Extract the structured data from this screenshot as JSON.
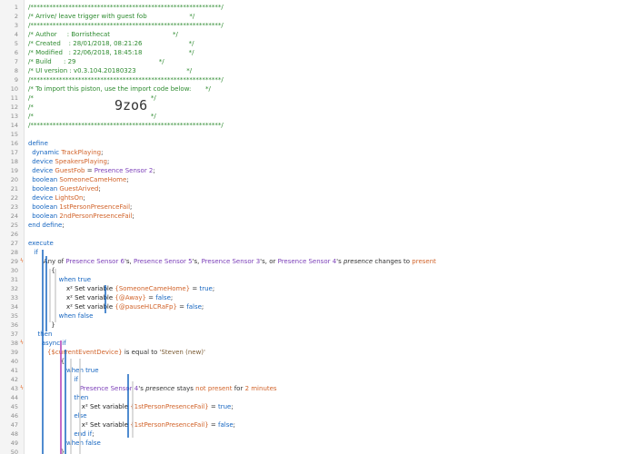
{
  "lines": [
    {
      "n": "1",
      "mk": "",
      "ind": 0,
      "seg": [
        {
          "c": "comment",
          "t": "/************************************************************/"
        }
      ]
    },
    {
      "n": "2",
      "mk": "",
      "ind": 0,
      "seg": [
        {
          "c": "comment",
          "t": "/* Arrive/ leave trigger with guest fob                     */"
        }
      ]
    },
    {
      "n": "3",
      "mk": "",
      "ind": 0,
      "seg": [
        {
          "c": "comment",
          "t": "/************************************************************/"
        }
      ]
    },
    {
      "n": "4",
      "mk": "",
      "ind": 0,
      "seg": [
        {
          "c": "comment",
          "t": "/* Author     : Borristhecat                               */"
        }
      ]
    },
    {
      "n": "5",
      "mk": "",
      "ind": 0,
      "seg": [
        {
          "c": "comment",
          "t": "/* Created    : 28/01/2018, 08:21:26                       */"
        }
      ]
    },
    {
      "n": "6",
      "mk": "",
      "ind": 0,
      "seg": [
        {
          "c": "comment",
          "t": "/* Modified   : 22/06/2018, 18:45:18                       */"
        }
      ]
    },
    {
      "n": "7",
      "mk": "",
      "ind": 0,
      "seg": [
        {
          "c": "comment",
          "t": "/* Build      : 29                                         */"
        }
      ]
    },
    {
      "n": "8",
      "mk": "",
      "ind": 0,
      "seg": [
        {
          "c": "comment",
          "t": "/* UI version : v0.3.104.20180323                         */"
        }
      ]
    },
    {
      "n": "9",
      "mk": "",
      "ind": 0,
      "seg": [
        {
          "c": "comment",
          "t": "/************************************************************/"
        }
      ]
    },
    {
      "n": "10",
      "mk": "",
      "ind": 0,
      "seg": [
        {
          "c": "comment",
          "t": "/* To import this piston, use the import code below:       */"
        }
      ]
    },
    {
      "n": "11",
      "mk": "",
      "ind": 0,
      "seg": [
        {
          "c": "comment",
          "t": "/*                                                          */"
        }
      ]
    },
    {
      "n": "12",
      "mk": "",
      "ind": 0,
      "seg": [
        {
          "c": "comment",
          "t": "/*"
        }
      ]
    },
    {
      "n": "13",
      "mk": "",
      "ind": 0,
      "seg": [
        {
          "c": "comment",
          "t": "/*                                                          */"
        }
      ]
    },
    {
      "n": "14",
      "mk": "",
      "ind": 0,
      "seg": [
        {
          "c": "comment",
          "t": "/************************************************************/"
        }
      ]
    },
    {
      "n": "15",
      "mk": "",
      "ind": 0,
      "seg": []
    },
    {
      "n": "16",
      "mk": "",
      "ind": 0,
      "seg": [
        {
          "c": "kw",
          "t": "define"
        }
      ]
    },
    {
      "n": "17",
      "mk": "",
      "ind": 1,
      "seg": [
        {
          "c": "kw",
          "t": "dynamic "
        },
        {
          "c": "var",
          "t": "TrackPlaying"
        },
        {
          "c": "txt",
          "t": ";"
        }
      ]
    },
    {
      "n": "18",
      "mk": "",
      "ind": 1,
      "seg": [
        {
          "c": "kw",
          "t": "device "
        },
        {
          "c": "var",
          "t": "SpeakersPlaying"
        },
        {
          "c": "txt",
          "t": ";"
        }
      ]
    },
    {
      "n": "19",
      "mk": "",
      "ind": 1,
      "seg": [
        {
          "c": "kw",
          "t": "device "
        },
        {
          "c": "var",
          "t": "GuestFob"
        },
        {
          "c": "txt",
          "t": " = "
        },
        {
          "c": "dev",
          "t": "Presence Sensor 2"
        },
        {
          "c": "txt",
          "t": ";"
        }
      ]
    },
    {
      "n": "20",
      "mk": "",
      "ind": 1,
      "seg": [
        {
          "c": "kw",
          "t": "boolean "
        },
        {
          "c": "var",
          "t": "SomeoneCameHome"
        },
        {
          "c": "txt",
          "t": ";"
        }
      ]
    },
    {
      "n": "21",
      "mk": "",
      "ind": 1,
      "seg": [
        {
          "c": "kw",
          "t": "boolean "
        },
        {
          "c": "var",
          "t": "GuestArived"
        },
        {
          "c": "txt",
          "t": ";"
        }
      ]
    },
    {
      "n": "22",
      "mk": "",
      "ind": 1,
      "seg": [
        {
          "c": "kw",
          "t": "device "
        },
        {
          "c": "var",
          "t": "LightsOn"
        },
        {
          "c": "txt",
          "t": ";"
        }
      ]
    },
    {
      "n": "23",
      "mk": "",
      "ind": 1,
      "seg": [
        {
          "c": "kw",
          "t": "boolean "
        },
        {
          "c": "var",
          "t": "1stPersonPresenceFail"
        },
        {
          "c": "txt",
          "t": ";"
        }
      ]
    },
    {
      "n": "24",
      "mk": "",
      "ind": 1,
      "seg": [
        {
          "c": "kw",
          "t": "boolean "
        },
        {
          "c": "var",
          "t": "2ndPersonPresenceFail"
        },
        {
          "c": "txt",
          "t": ";"
        }
      ]
    },
    {
      "n": "25",
      "mk": "",
      "ind": 0,
      "seg": [
        {
          "c": "kw",
          "t": "end define"
        },
        {
          "c": "txt",
          "t": ";"
        }
      ]
    },
    {
      "n": "26",
      "mk": "",
      "ind": 0,
      "seg": []
    },
    {
      "n": "27",
      "mk": "",
      "ind": 0,
      "seg": [
        {
          "c": "kw",
          "t": "execute"
        }
      ]
    },
    {
      "n": "28",
      "mk": "",
      "ind": 1.5,
      "seg": [
        {
          "c": "kw",
          "t": "if"
        }
      ]
    },
    {
      "n": "29",
      "mk": "ϟ",
      "ind": 4,
      "seg": [
        {
          "c": "txt",
          "t": "Any of "
        },
        {
          "c": "dev",
          "t": "Presence Sensor 6"
        },
        {
          "c": "txt",
          "t": "'s, "
        },
        {
          "c": "dev",
          "t": "Presence Sensor 5"
        },
        {
          "c": "txt",
          "t": "'s, "
        },
        {
          "c": "dev",
          "t": "Presence Sensor 3"
        },
        {
          "c": "txt",
          "t": "'s, or "
        },
        {
          "c": "dev",
          "t": "Presence Sensor 4"
        },
        {
          "c": "txt",
          "t": "'s "
        },
        {
          "c": "it",
          "t": "presence"
        },
        {
          "c": "txt",
          "t": " changes to "
        },
        {
          "c": "op",
          "t": "present"
        }
      ]
    },
    {
      "n": "30",
      "mk": "",
      "ind": 6,
      "seg": [
        {
          "c": "txt",
          "t": "{"
        }
      ]
    },
    {
      "n": "31",
      "mk": "",
      "ind": 8,
      "seg": [
        {
          "c": "kw",
          "t": "when true"
        }
      ]
    },
    {
      "n": "32",
      "mk": "",
      "ind": 10,
      "seg": [
        {
          "c": "x",
          "t": "x² Set variable "
        },
        {
          "c": "var",
          "t": "{SomeoneCameHome}"
        },
        {
          "c": "txt",
          "t": " = "
        },
        {
          "c": "kw",
          "t": "true"
        },
        {
          "c": "txt",
          "t": ";"
        }
      ]
    },
    {
      "n": "33",
      "mk": "",
      "ind": 10,
      "seg": [
        {
          "c": "x",
          "t": "x² Set variable "
        },
        {
          "c": "var",
          "t": "{@Away}"
        },
        {
          "c": "txt",
          "t": " = "
        },
        {
          "c": "kw",
          "t": "false"
        },
        {
          "c": "txt",
          "t": ";"
        }
      ]
    },
    {
      "n": "34",
      "mk": "",
      "ind": 10,
      "seg": [
        {
          "c": "x",
          "t": "x² Set variable "
        },
        {
          "c": "var",
          "t": "{@pauseHLCRaFp}"
        },
        {
          "c": "txt",
          "t": " = "
        },
        {
          "c": "kw",
          "t": "false"
        },
        {
          "c": "txt",
          "t": ";"
        }
      ]
    },
    {
      "n": "35",
      "mk": "",
      "ind": 8,
      "seg": [
        {
          "c": "kw",
          "t": "when false"
        }
      ]
    },
    {
      "n": "36",
      "mk": "",
      "ind": 6,
      "seg": [
        {
          "c": "txt",
          "t": "}"
        }
      ]
    },
    {
      "n": "37",
      "mk": "",
      "ind": 2.5,
      "seg": [
        {
          "c": "kw",
          "t": "then"
        }
      ]
    },
    {
      "n": "38",
      "mk": "ϟ",
      "ind": 3.5,
      "seg": [
        {
          "c": "kw",
          "t": "async if"
        }
      ]
    },
    {
      "n": "39",
      "mk": "",
      "ind": 5,
      "seg": [
        {
          "c": "var",
          "t": "{$currentEventDevice}"
        },
        {
          "c": "txt",
          "t": " is equal to "
        },
        {
          "c": "str",
          "t": "'Steven (new)'"
        }
      ]
    },
    {
      "n": "40",
      "mk": "",
      "ind": 8.5,
      "seg": [
        {
          "c": "txt",
          "t": "{"
        }
      ]
    },
    {
      "n": "41",
      "mk": "",
      "ind": 10,
      "seg": [
        {
          "c": "kw",
          "t": "when true"
        }
      ]
    },
    {
      "n": "42",
      "mk": "",
      "ind": 12,
      "seg": [
        {
          "c": "kw",
          "t": "if"
        }
      ]
    },
    {
      "n": "43",
      "mk": "ϟ",
      "ind": 13.5,
      "seg": [
        {
          "c": "dev",
          "t": "Presence Sensor 4"
        },
        {
          "c": "txt",
          "t": "'s "
        },
        {
          "c": "it",
          "t": "presence"
        },
        {
          "c": "txt",
          "t": " stays "
        },
        {
          "c": "op",
          "t": "not present"
        },
        {
          "c": "txt",
          "t": " for "
        },
        {
          "c": "op",
          "t": "2 minutes"
        }
      ]
    },
    {
      "n": "44",
      "mk": "",
      "ind": 12,
      "seg": [
        {
          "c": "kw",
          "t": "then"
        }
      ]
    },
    {
      "n": "45",
      "mk": "",
      "ind": 14,
      "seg": [
        {
          "c": "x",
          "t": "x² Set variable "
        },
        {
          "c": "var",
          "t": "{1stPersonPresenceFail}"
        },
        {
          "c": "txt",
          "t": " = "
        },
        {
          "c": "kw",
          "t": "true"
        },
        {
          "c": "txt",
          "t": ";"
        }
      ]
    },
    {
      "n": "46",
      "mk": "",
      "ind": 12,
      "seg": [
        {
          "c": "kw",
          "t": "else"
        }
      ]
    },
    {
      "n": "47",
      "mk": "",
      "ind": 14,
      "seg": [
        {
          "c": "x",
          "t": "x² Set variable "
        },
        {
          "c": "var",
          "t": "{1stPersonPresenceFail}"
        },
        {
          "c": "txt",
          "t": " = "
        },
        {
          "c": "kw",
          "t": "false"
        },
        {
          "c": "txt",
          "t": ";"
        }
      ]
    },
    {
      "n": "48",
      "mk": "",
      "ind": 12,
      "seg": [
        {
          "c": "kw",
          "t": "end if"
        },
        {
          "c": "txt",
          "t": ";"
        }
      ]
    },
    {
      "n": "49",
      "mk": "",
      "ind": 10,
      "seg": [
        {
          "c": "kw",
          "t": "when false"
        }
      ]
    },
    {
      "n": "50",
      "mk": "",
      "ind": 8.5,
      "seg": [
        {
          "c": "txt",
          "t": "}"
        }
      ]
    }
  ],
  "import_code": "9zo6",
  "colors": {
    "comment": "#2e8b30",
    "keyword": "#1565c0",
    "variable": "#d1632a",
    "device": "#7b3fb8",
    "gutter": "#f4f4f4"
  }
}
